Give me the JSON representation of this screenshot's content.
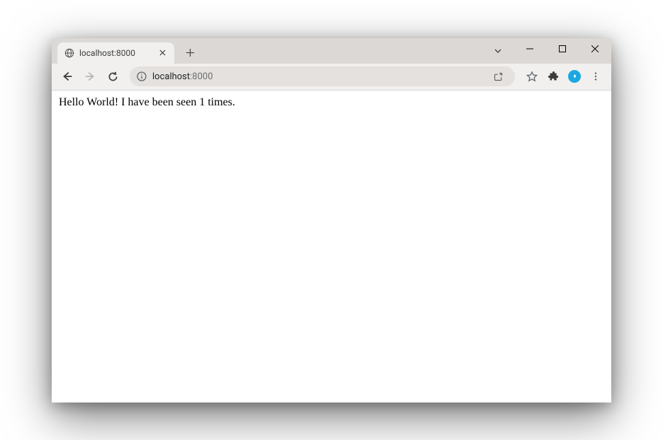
{
  "tab": {
    "title": "localhost:8000"
  },
  "addressBar": {
    "host": "localhost",
    "port": ":8000"
  },
  "page": {
    "body_text": "Hello World! I have been seen 1 times."
  }
}
